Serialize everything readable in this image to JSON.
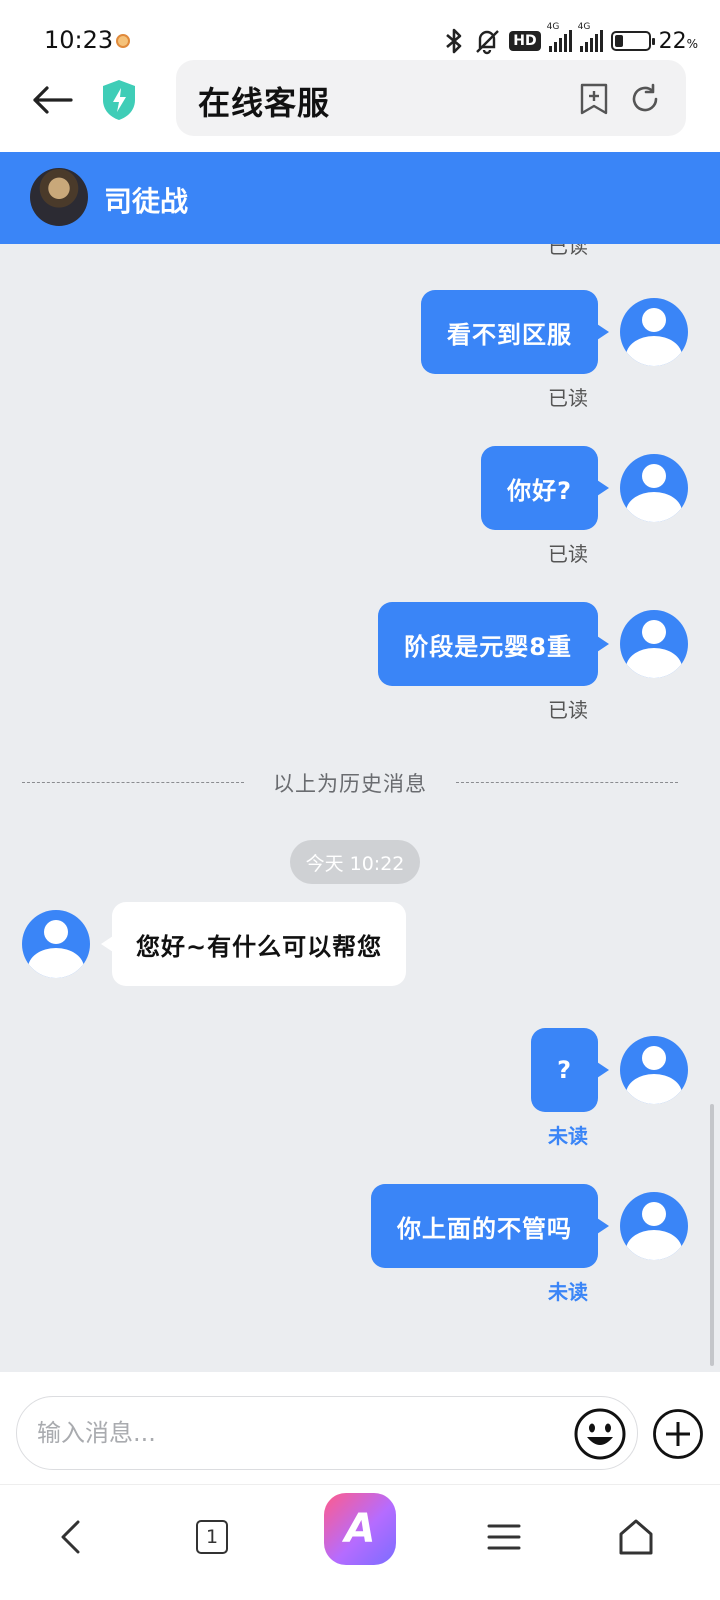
{
  "status_bar": {
    "time": "10:23",
    "hd_label": "HD",
    "signal_label_1": "4G",
    "signal_label_2": "4G",
    "battery_percent": "22",
    "battery_unit": "%"
  },
  "browser": {
    "page_title": "在线客服",
    "icons": {
      "back": "back-arrow-icon",
      "security": "shield-bolt-icon",
      "bookmark": "add-bookmark-icon",
      "reload": "reload-icon"
    }
  },
  "chat_header": {
    "agent_name": "司徒战",
    "color": "#3a85f7"
  },
  "messages": {
    "partial_status": "已读",
    "history": [
      {
        "text": "看不到区服",
        "status": "已读"
      },
      {
        "text": "你好?",
        "status": "已读"
      },
      {
        "text": "阶段是元婴8重",
        "status": "已读"
      }
    ],
    "divider": "以上为历史消息",
    "timestamp": "今天 10:22",
    "incoming": {
      "text": "您好~有什么可以帮您"
    },
    "recent": [
      {
        "text": "?",
        "status": "未读"
      },
      {
        "text": "你上面的不管吗",
        "status": "未读"
      }
    ]
  },
  "input": {
    "placeholder": "输入消息...",
    "value": ""
  },
  "bottom_nav": {
    "tab_count": "1",
    "logo_letter": "A"
  },
  "colors": {
    "accent": "#3a85f7",
    "chat_bg": "#ebedf0",
    "unread": "#3a85f7"
  }
}
